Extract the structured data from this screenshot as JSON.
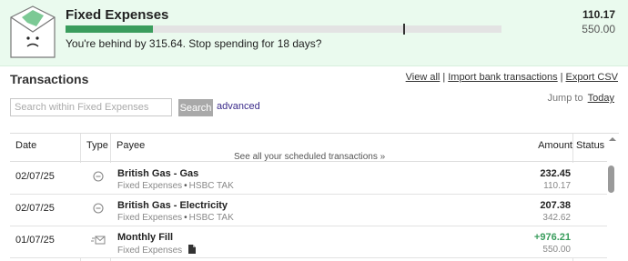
{
  "envelope": {
    "name": "Fixed Expenses",
    "spent": "110.17",
    "budget": "550.00",
    "message": "You're behind by 315.64. Stop spending for 18 days?",
    "progress_fraction": 0.2,
    "marker_fraction": 0.774,
    "icon": "sad-envelope-icon",
    "colors": {
      "panel": "#eafaee",
      "progress": "#3a9d5d",
      "positive": "#3a9d5d",
      "link_purple": "#3a2a8a"
    }
  },
  "transactions": {
    "title": "Transactions",
    "links": {
      "view_all": "View all",
      "import": "Import bank transactions",
      "export": "Export CSV",
      "separator": "|"
    },
    "jump_label": "Jump to",
    "jump_today": "Today",
    "search": {
      "placeholder": "Search within Fixed Expenses",
      "button": "Search",
      "advanced": "advanced"
    },
    "columns": {
      "date": "Date",
      "type": "Type",
      "payee": "Payee",
      "amount": "Amount",
      "status": "Status"
    },
    "scheduled_note": "See all your scheduled transactions »",
    "rows": [
      {
        "date": "02/07/25",
        "type_icon": "minus-circle-icon",
        "payee": "British Gas - Gas",
        "envelope": "Fixed Expenses",
        "account": "HSBC TAK",
        "amount": "232.45",
        "balance": "110.17"
      },
      {
        "date": "02/07/25",
        "type_icon": "minus-circle-icon",
        "payee": "British Gas - Electricity",
        "envelope": "Fixed Expenses",
        "account": "HSBC TAK",
        "amount": "207.38",
        "balance": "342.62"
      },
      {
        "date": "01/07/25",
        "type_icon": "envelope-fill-icon",
        "payee": "Monthly Fill",
        "envelope": "Fixed Expenses",
        "note_icon": "document-icon",
        "amount": "+976.21",
        "balance": "550.00"
      }
    ]
  }
}
